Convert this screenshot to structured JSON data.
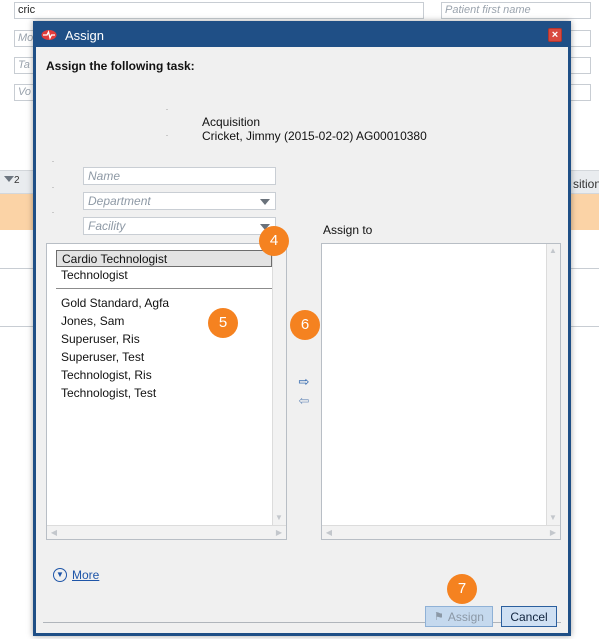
{
  "background": {
    "search_value": "cric",
    "patient_first_name_placeholder": "Patient first name",
    "field_m": "Mo",
    "field_t": "Ta",
    "field_v": "Vo",
    "count": "2",
    "column_tail": "sition"
  },
  "dialog": {
    "title": "Assign",
    "heading": "Assign the following task:",
    "task_name": "Acquisition",
    "task_patient": "Cricket, Jimmy (2015-02-02) AG00010380",
    "filters": {
      "name_placeholder": "Name",
      "department_placeholder": "Department",
      "facility_placeholder": "Facility"
    },
    "assign_to_label": "Assign to",
    "roles": [
      "Cardio Technologist",
      "Technologist"
    ],
    "selected_role": "Cardio Technologist",
    "users": [
      "Gold Standard, Agfa",
      "Jones, Sam",
      "Superuser, Ris",
      "Superuser, Test",
      "Technologist, Ris",
      "Technologist, Test"
    ],
    "more_label": "More",
    "assign_button": "Assign",
    "cancel_button": "Cancel"
  },
  "callouts": [
    "4",
    "5",
    "6",
    "7"
  ],
  "colors": {
    "dialog_frame": "#1f4f86",
    "callout": "#f58220",
    "link": "#1e55a8"
  }
}
